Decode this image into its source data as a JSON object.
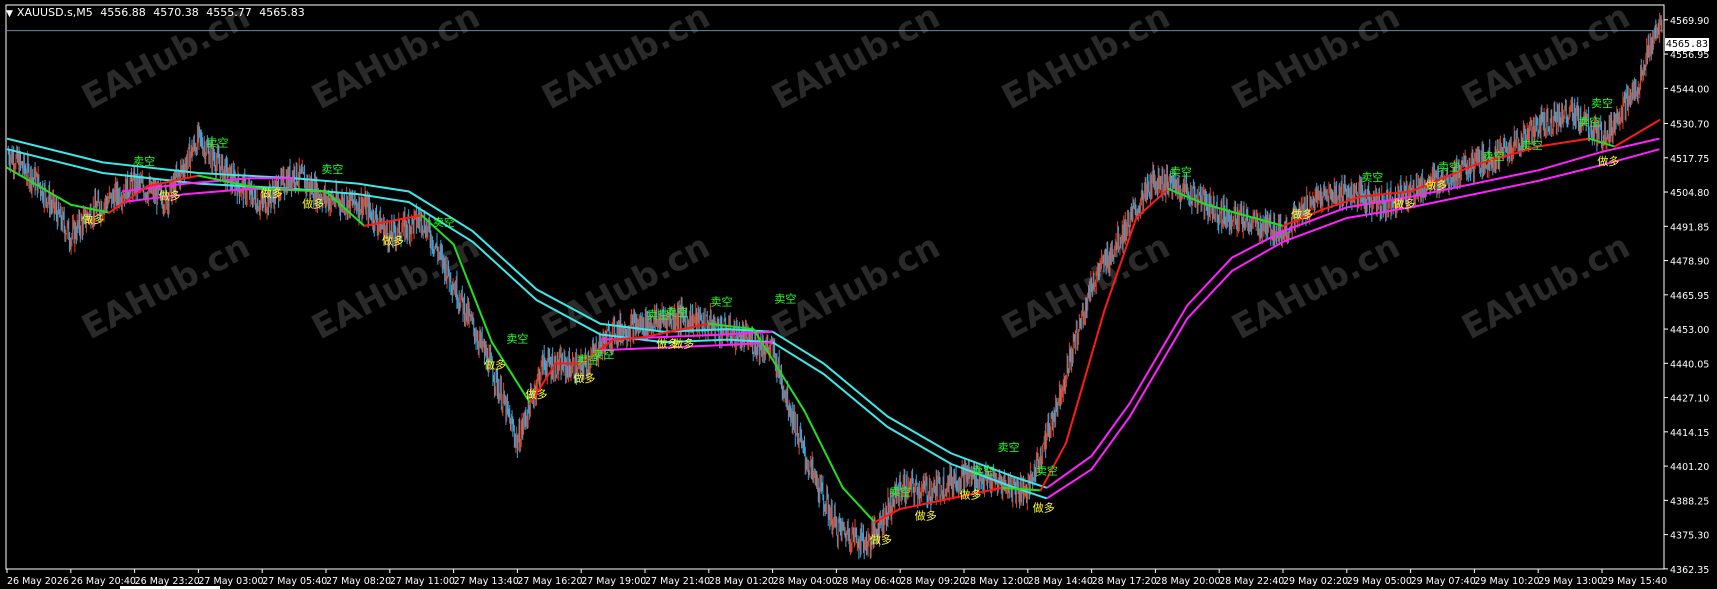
{
  "header": {
    "symbol": "XAUUSD.s,M5",
    "open": "4556.88",
    "high": "4570.38",
    "low": "4555.77",
    "close": "4565.83"
  },
  "watermark": "EAHub.cn",
  "signal_labels": {
    "sell": "卖空",
    "buy": "做多"
  },
  "colors": {
    "background": "#000000",
    "frame": "#ffffff",
    "bull_bar": "#e04828",
    "bear_bar": "#3aa8e0",
    "fast_line_up": "#ff1a1a",
    "fast_line_down": "#20e020",
    "slow_band": "#3de8e8",
    "slow_band_up": "#ff22ff",
    "sell_label": "#22ff22",
    "buy_label": "#ffff33",
    "axis_text": "#ffffff",
    "current_price_line": "#6a8aa0"
  },
  "chart_data": {
    "type": "line",
    "title": "",
    "ylim": [
      4362.3,
      4575.5
    ],
    "y_ticks": [
      "4569.90",
      "4556.95",
      "4544.00",
      "4530.70",
      "4517.75",
      "4504.80",
      "4491.85",
      "4478.90",
      "4465.95",
      "4453.00",
      "4440.05",
      "4427.10",
      "4414.15",
      "4401.20",
      "4388.25",
      "4375.30",
      "4362.35"
    ],
    "current_price": "4565.83",
    "x_ticks": [
      "26 May 2026",
      "26 May 20:40",
      "26 May 23:20",
      "27 May 03:00",
      "27 May 05:40",
      "27 May 08:20",
      "27 May 11:00",
      "27 May 13:40",
      "27 May 16:20",
      "27 May 19:00",
      "27 May 21:40",
      "28 May 01:20",
      "28 May 04:00",
      "28 May 06:40",
      "28 May 09:20",
      "28 May 12:00",
      "28 May 14:40",
      "28 May 17:20",
      "28 May 20:00",
      "28 May 22:40",
      "29 May 02:20",
      "29 May 05:00",
      "29 May 07:40",
      "29 May 10:20",
      "29 May 13:00",
      "29 May 15:40"
    ],
    "price_path": [
      {
        "x": 0,
        "y": 4520
      },
      {
        "x": 0.5,
        "y": 4508
      },
      {
        "x": 1.0,
        "y": 4488
      },
      {
        "x": 1.3,
        "y": 4497
      },
      {
        "x": 2.0,
        "y": 4508
      },
      {
        "x": 2.5,
        "y": 4502
      },
      {
        "x": 3.0,
        "y": 4525
      },
      {
        "x": 3.5,
        "y": 4510
      },
      {
        "x": 4.0,
        "y": 4500
      },
      {
        "x": 4.5,
        "y": 4512
      },
      {
        "x": 5.0,
        "y": 4502
      },
      {
        "x": 5.6,
        "y": 4500
      },
      {
        "x": 6.0,
        "y": 4488
      },
      {
        "x": 6.5,
        "y": 4495
      },
      {
        "x": 7.0,
        "y": 4470
      },
      {
        "x": 7.6,
        "y": 4438
      },
      {
        "x": 8.0,
        "y": 4410
      },
      {
        "x": 8.4,
        "y": 4440
      },
      {
        "x": 9.0,
        "y": 4438
      },
      {
        "x": 9.5,
        "y": 4452
      },
      {
        "x": 10.0,
        "y": 4455
      },
      {
        "x": 10.5,
        "y": 4458
      },
      {
        "x": 11.0,
        "y": 4455
      },
      {
        "x": 11.5,
        "y": 4450
      },
      {
        "x": 12.0,
        "y": 4445
      },
      {
        "x": 12.5,
        "y": 4405
      },
      {
        "x": 13.0,
        "y": 4378
      },
      {
        "x": 13.5,
        "y": 4372
      },
      {
        "x": 14.0,
        "y": 4393
      },
      {
        "x": 14.5,
        "y": 4392
      },
      {
        "x": 15.0,
        "y": 4398
      },
      {
        "x": 15.5,
        "y": 4395
      },
      {
        "x": 16.0,
        "y": 4392
      },
      {
        "x": 16.4,
        "y": 4420
      },
      {
        "x": 17.0,
        "y": 4470
      },
      {
        "x": 17.5,
        "y": 4490
      },
      {
        "x": 18.0,
        "y": 4510
      },
      {
        "x": 18.5,
        "y": 4505
      },
      {
        "x": 19.0,
        "y": 4497
      },
      {
        "x": 19.5,
        "y": 4493
      },
      {
        "x": 20.0,
        "y": 4490
      },
      {
        "x": 20.5,
        "y": 4502
      },
      {
        "x": 21.0,
        "y": 4505
      },
      {
        "x": 21.5,
        "y": 4500
      },
      {
        "x": 22.0,
        "y": 4505
      },
      {
        "x": 22.5,
        "y": 4510
      },
      {
        "x": 23.0,
        "y": 4515
      },
      {
        "x": 23.5,
        "y": 4520
      },
      {
        "x": 24.0,
        "y": 4530
      },
      {
        "x": 24.5,
        "y": 4535
      },
      {
        "x": 25.0,
        "y": 4525
      },
      {
        "x": 25.5,
        "y": 4542
      },
      {
        "x": 25.9,
        "y": 4568
      }
    ],
    "series": [
      {
        "values": [
          {
            "x": 0,
            "y": 4514
          },
          {
            "x": 1.0,
            "y": 4500
          },
          {
            "x": 1.6,
            "y": 4497
          },
          {
            "x": 2.2,
            "y": 4507
          },
          {
            "x": 3.0,
            "y": 4511
          },
          {
            "x": 4.0,
            "y": 4506
          },
          {
            "x": 5.0,
            "y": 4505
          },
          {
            "x": 5.6,
            "y": 4492
          },
          {
            "x": 6.5,
            "y": 4496
          },
          {
            "x": 7.0,
            "y": 4485
          },
          {
            "x": 7.6,
            "y": 4448
          },
          {
            "x": 8.2,
            "y": 4425
          },
          {
            "x": 8.6,
            "y": 4440
          },
          {
            "x": 9.0,
            "y": 4440
          },
          {
            "x": 9.5,
            "y": 4449
          },
          {
            "x": 10.0,
            "y": 4450
          },
          {
            "x": 11.0,
            "y": 4455
          },
          {
            "x": 11.7,
            "y": 4453
          },
          {
            "x": 12.5,
            "y": 4422
          },
          {
            "x": 13.1,
            "y": 4393
          },
          {
            "x": 13.6,
            "y": 4380
          },
          {
            "x": 14.0,
            "y": 4385
          },
          {
            "x": 15.0,
            "y": 4390
          },
          {
            "x": 15.6,
            "y": 4393
          },
          {
            "x": 16.2,
            "y": 4392
          },
          {
            "x": 16.6,
            "y": 4410
          },
          {
            "x": 17.2,
            "y": 4460
          },
          {
            "x": 17.7,
            "y": 4495
          },
          {
            "x": 18.2,
            "y": 4506
          },
          {
            "x": 18.8,
            "y": 4500
          },
          {
            "x": 20.0,
            "y": 4492
          },
          {
            "x": 20.6,
            "y": 4498
          },
          {
            "x": 21.2,
            "y": 4503
          },
          {
            "x": 22.0,
            "y": 4505
          },
          {
            "x": 23.0,
            "y": 4515
          },
          {
            "x": 24.0,
            "y": 4522
          },
          {
            "x": 24.8,
            "y": 4525
          },
          {
            "x": 25.2,
            "y": 4522
          },
          {
            "x": 25.9,
            "y": 4532
          }
        ]
      },
      {
        "values": [
          {
            "x": 0,
            "y": 4525
          },
          {
            "x": 1.5,
            "y": 4516
          },
          {
            "x": 3.0,
            "y": 4512
          },
          {
            "x": 4.5,
            "y": 4510
          },
          {
            "x": 5.5,
            "y": 4508
          },
          {
            "x": 6.3,
            "y": 4505
          },
          {
            "x": 7.3,
            "y": 4490
          },
          {
            "x": 8.3,
            "y": 4468
          },
          {
            "x": 9.3,
            "y": 4455
          },
          {
            "x": 10.3,
            "y": 4452
          },
          {
            "x": 11.3,
            "y": 4453
          },
          {
            "x": 12.0,
            "y": 4452
          },
          {
            "x": 12.8,
            "y": 4440
          },
          {
            "x": 13.8,
            "y": 4420
          },
          {
            "x": 14.8,
            "y": 4406
          },
          {
            "x": 15.8,
            "y": 4397
          },
          {
            "x": 16.3,
            "y": 4393
          }
        ]
      },
      {
        "values": [
          {
            "x": 0,
            "y": 4521
          },
          {
            "x": 1.5,
            "y": 4512
          },
          {
            "x": 3.0,
            "y": 4508
          },
          {
            "x": 4.5,
            "y": 4506
          },
          {
            "x": 5.5,
            "y": 4504
          },
          {
            "x": 6.3,
            "y": 4501
          },
          {
            "x": 7.3,
            "y": 4486
          },
          {
            "x": 8.3,
            "y": 4464
          },
          {
            "x": 9.3,
            "y": 4451
          },
          {
            "x": 10.3,
            "y": 4448
          },
          {
            "x": 11.3,
            "y": 4449
          },
          {
            "x": 12.0,
            "y": 4448
          },
          {
            "x": 12.8,
            "y": 4436
          },
          {
            "x": 13.8,
            "y": 4416
          },
          {
            "x": 14.8,
            "y": 4402
          },
          {
            "x": 15.8,
            "y": 4393
          },
          {
            "x": 16.3,
            "y": 4389
          }
        ]
      },
      {
        "values": [
          {
            "x": 1.8,
            "y": 4505
          },
          {
            "x": 2.8,
            "y": 4508
          },
          {
            "x": 3.8,
            "y": 4510
          },
          {
            "x": 4.5,
            "y": 4510
          },
          {
            "x": 9.3,
            "y": 4449
          },
          {
            "x": 10.3,
            "y": 4450
          },
          {
            "x": 11.3,
            "y": 4451
          },
          {
            "x": 12.0,
            "y": 4452
          },
          {
            "x": 16.3,
            "y": 4393
          },
          {
            "x": 17.0,
            "y": 4405
          },
          {
            "x": 17.6,
            "y": 4425
          },
          {
            "x": 18.5,
            "y": 4462
          },
          {
            "x": 19.2,
            "y": 4480
          },
          {
            "x": 20.0,
            "y": 4490
          },
          {
            "x": 21.0,
            "y": 4499
          },
          {
            "x": 22.0,
            "y": 4503
          },
          {
            "x": 23.0,
            "y": 4508
          },
          {
            "x": 24.0,
            "y": 4513
          },
          {
            "x": 25.0,
            "y": 4520
          },
          {
            "x": 25.9,
            "y": 4525
          }
        ]
      },
      {
        "values": [
          {
            "x": 1.8,
            "y": 4501
          },
          {
            "x": 2.8,
            "y": 4504
          },
          {
            "x": 3.8,
            "y": 4506
          },
          {
            "x": 4.5,
            "y": 4506
          },
          {
            "x": 9.3,
            "y": 4445
          },
          {
            "x": 10.3,
            "y": 4446
          },
          {
            "x": 11.3,
            "y": 4447
          },
          {
            "x": 12.0,
            "y": 4448
          },
          {
            "x": 16.3,
            "y": 4389
          },
          {
            "x": 17.0,
            "y": 4400
          },
          {
            "x": 17.6,
            "y": 4420
          },
          {
            "x": 18.5,
            "y": 4457
          },
          {
            "x": 19.2,
            "y": 4475
          },
          {
            "x": 20.0,
            "y": 4486
          },
          {
            "x": 21.0,
            "y": 4495
          },
          {
            "x": 22.0,
            "y": 4499
          },
          {
            "x": 23.0,
            "y": 4504
          },
          {
            "x": 24.0,
            "y": 4509
          },
          {
            "x": 25.0,
            "y": 4515
          },
          {
            "x": 25.9,
            "y": 4521
          }
        ]
      }
    ],
    "signals": [
      {
        "type": "sell",
        "x": 2.15,
        "y": 4515
      },
      {
        "x": 3.3,
        "type": "sell",
        "y": 4522
      },
      {
        "x": 5.1,
        "type": "sell",
        "y": 4512
      },
      {
        "x": 6.85,
        "type": "sell",
        "y": 4492
      },
      {
        "x": 8.0,
        "type": "sell",
        "y": 4448
      },
      {
        "x": 9.1,
        "type": "sell",
        "y": 4440
      },
      {
        "x": 9.35,
        "type": "sell",
        "y": 4442
      },
      {
        "x": 10.2,
        "type": "sell",
        "y": 4457
      },
      {
        "x": 10.5,
        "type": "sell",
        "y": 4458
      },
      {
        "x": 11.2,
        "type": "sell",
        "y": 4462
      },
      {
        "x": 12.2,
        "type": "sell",
        "y": 4463
      },
      {
        "x": 14.0,
        "type": "sell",
        "y": 4390
      },
      {
        "x": 15.3,
        "type": "sell",
        "y": 4398
      },
      {
        "x": 15.7,
        "type": "sell",
        "y": 4407
      },
      {
        "x": 16.3,
        "type": "sell",
        "y": 4398
      },
      {
        "x": 18.4,
        "type": "sell",
        "y": 4511
      },
      {
        "x": 21.4,
        "type": "sell",
        "y": 4509
      },
      {
        "x": 22.6,
        "type": "sell",
        "y": 4513
      },
      {
        "x": 23.3,
        "type": "sell",
        "y": 4517
      },
      {
        "x": 23.9,
        "type": "sell",
        "y": 4521
      },
      {
        "x": 24.8,
        "type": "sell",
        "y": 4530
      },
      {
        "x": 25.0,
        "type": "sell",
        "y": 4537
      },
      {
        "x": 1.35,
        "type": "buy",
        "y": 4493
      },
      {
        "x": 2.55,
        "type": "buy",
        "y": 4502
      },
      {
        "x": 4.15,
        "type": "buy",
        "y": 4503
      },
      {
        "x": 4.8,
        "type": "buy",
        "y": 4499
      },
      {
        "x": 6.05,
        "type": "buy",
        "y": 4485
      },
      {
        "x": 7.65,
        "type": "buy",
        "y": 4438
      },
      {
        "x": 8.3,
        "type": "buy",
        "y": 4427
      },
      {
        "x": 9.05,
        "type": "buy",
        "y": 4433
      },
      {
        "x": 10.35,
        "type": "buy",
        "y": 4446
      },
      {
        "x": 10.6,
        "type": "buy",
        "y": 4446
      },
      {
        "x": 13.7,
        "type": "buy",
        "y": 4372
      },
      {
        "x": 14.4,
        "type": "buy",
        "y": 4381
      },
      {
        "x": 15.1,
        "type": "buy",
        "y": 4389
      },
      {
        "x": 16.25,
        "type": "buy",
        "y": 4384
      },
      {
        "x": 20.3,
        "type": "buy",
        "y": 4495
      },
      {
        "x": 21.9,
        "type": "buy",
        "y": 4499
      },
      {
        "x": 22.4,
        "type": "buy",
        "y": 4506
      },
      {
        "x": 25.1,
        "type": "buy",
        "y": 4515
      }
    ]
  }
}
